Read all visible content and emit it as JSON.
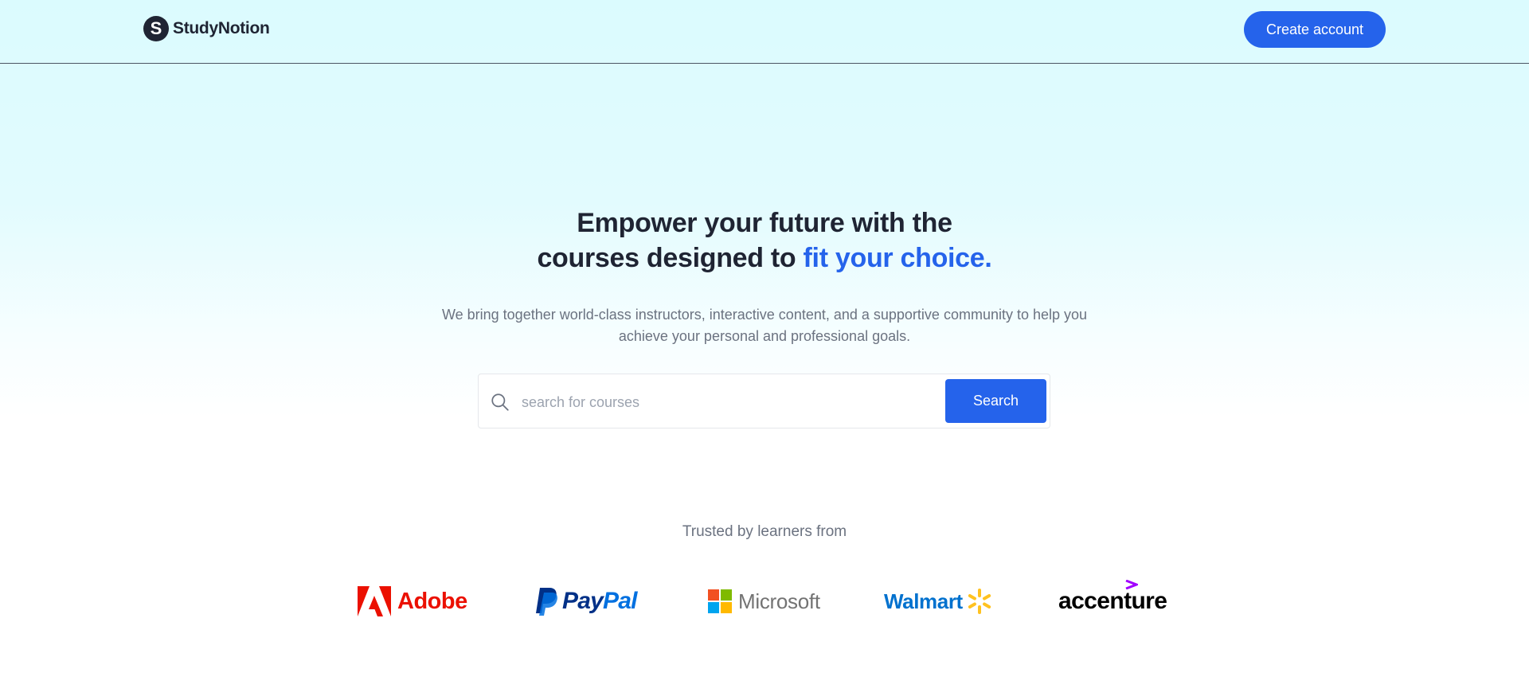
{
  "header": {
    "brand_initial": "S",
    "brand_name": "StudyNotion",
    "create_account_label": "Create account"
  },
  "hero": {
    "title_line1": "Empower your future with the",
    "title_line2_prefix": "courses designed to ",
    "title_line2_accent": "fit your choice.",
    "subtitle": "We bring together world-class instructors, interactive content, and a supportive community to help you achieve your personal and professional goals."
  },
  "search": {
    "placeholder": "search for courses",
    "value": "",
    "button_label": "Search",
    "icon": "search-icon"
  },
  "trusted": {
    "heading": "Trusted by learners from",
    "logos": [
      {
        "name": "Adobe",
        "icon": "adobe-logo"
      },
      {
        "name_part1": "Pay",
        "name_part2": "Pal",
        "icon": "paypal-logo"
      },
      {
        "name": "Microsoft",
        "icon": "microsoft-logo"
      },
      {
        "name": "Walmart",
        "icon": "walmart-logo"
      },
      {
        "name": "accenture",
        "icon": "accenture-logo"
      }
    ]
  },
  "colors": {
    "accent": "#2563eb",
    "brand_dark": "#1f2433",
    "muted_text": "#6b7280",
    "adobe_red": "#eb1000",
    "paypal_dark": "#003087",
    "paypal_light": "#0070e0",
    "walmart_blue": "#0071ce",
    "walmart_spark": "#ffc220",
    "accenture_purple": "#a100ff"
  }
}
